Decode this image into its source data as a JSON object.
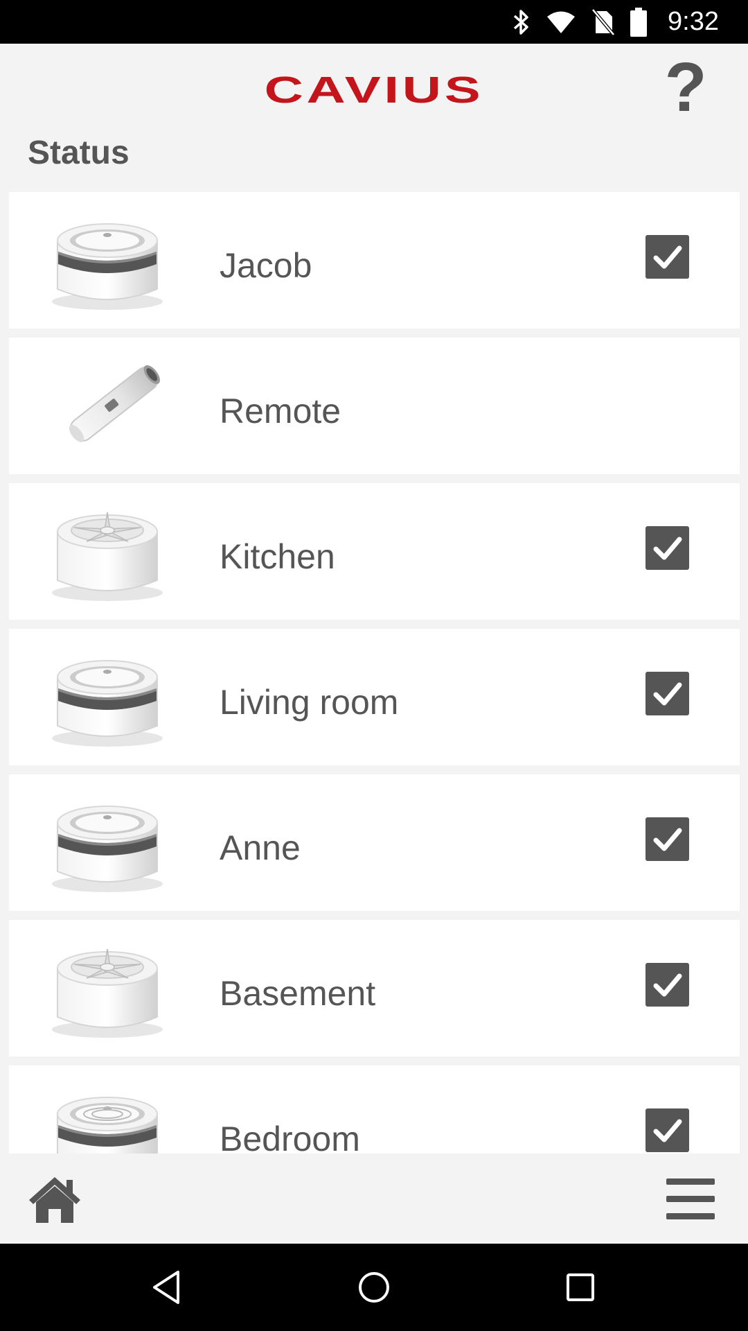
{
  "status_bar": {
    "time": "9:32",
    "icons": [
      "bluetooth-icon",
      "wifi-icon",
      "no-sim-icon",
      "battery-icon"
    ]
  },
  "header": {
    "logo_text": "CAVIUS",
    "logo_color": "#c4151c",
    "help_label": "?"
  },
  "status_heading": "Status",
  "devices": [
    {
      "name": "Jacob",
      "type": "smoke-alarm",
      "checked": true
    },
    {
      "name": "Remote",
      "type": "remote-control",
      "checked": false
    },
    {
      "name": "Kitchen",
      "type": "heat-alarm",
      "checked": true
    },
    {
      "name": "Living room",
      "type": "smoke-alarm",
      "checked": true
    },
    {
      "name": "Anne",
      "type": "smoke-alarm",
      "checked": true
    },
    {
      "name": "Basement",
      "type": "heat-alarm",
      "checked": true
    },
    {
      "name": "Bedroom",
      "type": "smoke-alarm-vented",
      "checked": true
    }
  ],
  "bottom_bar": {
    "left_icon": "home-icon",
    "right_icon": "hamburger-menu-icon"
  },
  "nav_bar": {
    "icons": [
      "back-icon",
      "home-circle-icon",
      "recents-icon"
    ]
  },
  "colors": {
    "accent": "#c4151c",
    "text": "#555555",
    "background": "#f3f3f3"
  }
}
